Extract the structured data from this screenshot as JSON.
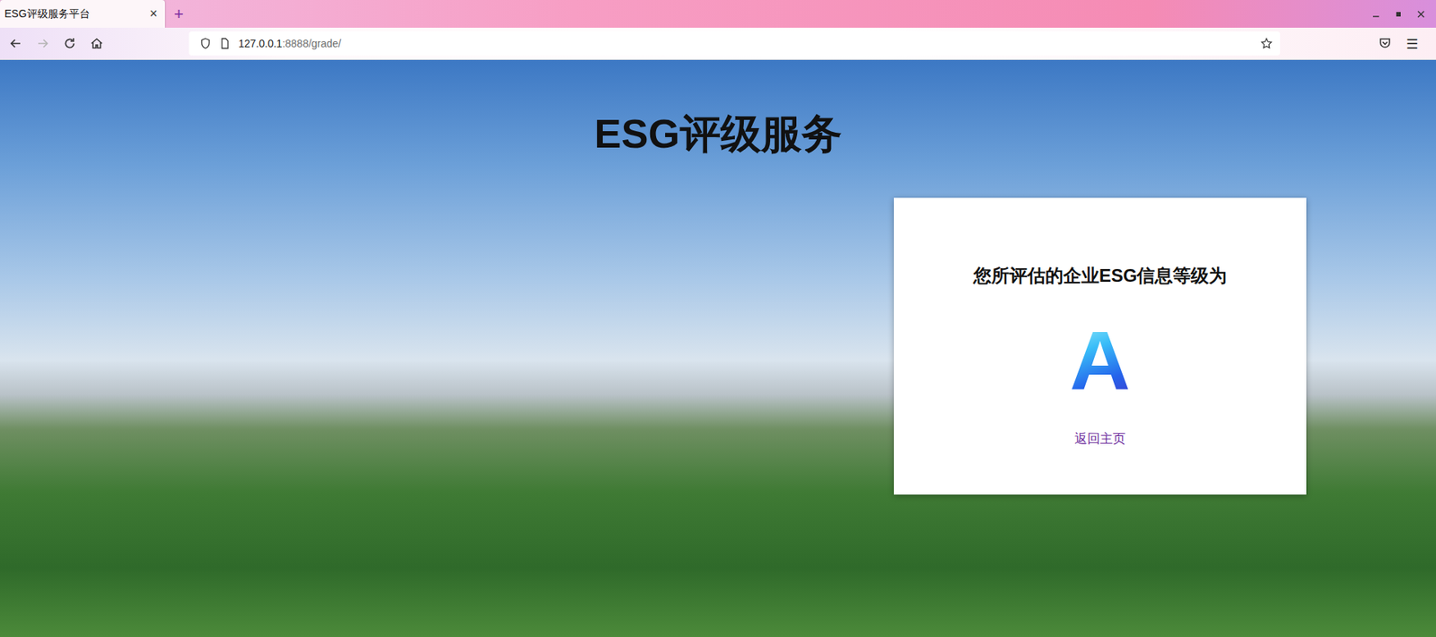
{
  "window": {
    "title": "ESG评级服务平台"
  },
  "tabs": [
    {
      "label": "ESG评级服务平台",
      "selected": true,
      "close": "×"
    }
  ],
  "new_tab": "+",
  "toolbar": {
    "back_disabled": false,
    "forward_disabled": true
  },
  "address": {
    "host": "127.0.0.1",
    "rest": ":8888/grade/"
  },
  "menu_glyph": "☰",
  "page": {
    "title": "ESG评级服务",
    "card": {
      "heading": "您所评估的企业ESG信息等级为",
      "grade": "A",
      "link": "返回主页"
    }
  }
}
